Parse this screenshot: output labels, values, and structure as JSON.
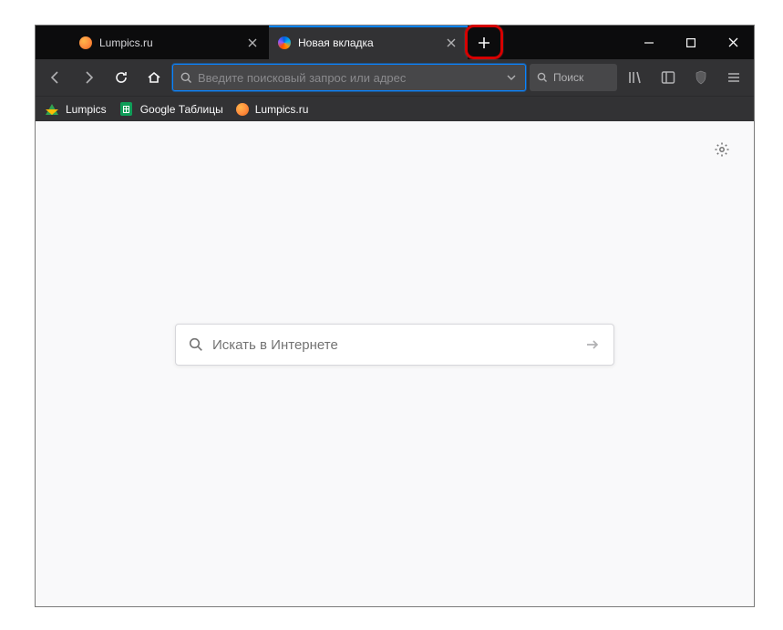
{
  "tabs": [
    {
      "title": "Lumpics.ru",
      "icon": "lumpics",
      "active": false
    },
    {
      "title": "Новая вкладка",
      "icon": "firefox",
      "active": true
    }
  ],
  "urlbar": {
    "placeholder": "Введите поисковый запрос или адрес"
  },
  "searchbar": {
    "placeholder": "Поиск"
  },
  "bookmarks": [
    {
      "label": "Lumpics",
      "icon": "drive"
    },
    {
      "label": "Google Таблицы",
      "icon": "sheets"
    },
    {
      "label": "Lumpics.ru",
      "icon": "lumpics"
    }
  ],
  "newtab_search": {
    "placeholder": "Искать в Интернете"
  }
}
